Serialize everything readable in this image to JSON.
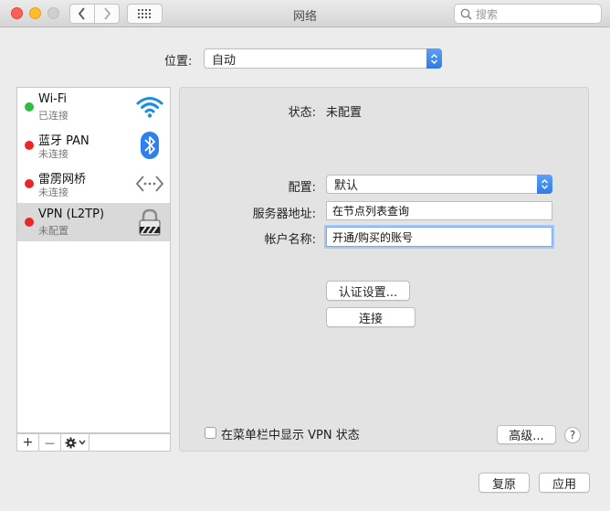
{
  "window": {
    "title": "网络",
    "search_placeholder": "搜索"
  },
  "location": {
    "label": "位置:",
    "value": "自动"
  },
  "services": [
    {
      "name": "Wi-Fi",
      "status": "已连接",
      "status_color": "#2fbd3f",
      "icon": "wifi-icon"
    },
    {
      "name": "蓝牙 PAN",
      "status": "未连接",
      "status_color": "#e8262b",
      "icon": "bluetooth-icon"
    },
    {
      "name": "雷雳网桥",
      "status": "未连接",
      "status_color": "#e8262b",
      "icon": "thunderbolt-bridge-icon"
    },
    {
      "name": "VPN (L2TP)",
      "status": "未配置",
      "status_color": "#e8262b",
      "icon": "vpn-lock-icon"
    }
  ],
  "detail": {
    "status_label": "状态:",
    "status_value": "未配置",
    "config_label": "配置:",
    "config_value": "默认",
    "server_label": "服务器地址:",
    "server_value": "在节点列表查询",
    "account_label": "帐户名称:",
    "account_value": "开通/购买的账号",
    "auth_button": "认证设置...",
    "connect_button": "连接",
    "show_vpn_label": "在菜单栏中显示 VPN 状态",
    "advanced_button": "高级...",
    "help_button": "?"
  },
  "footer": {
    "revert_button": "复原",
    "apply_button": "应用"
  },
  "toolbar": {
    "add": "+",
    "remove": "—"
  }
}
